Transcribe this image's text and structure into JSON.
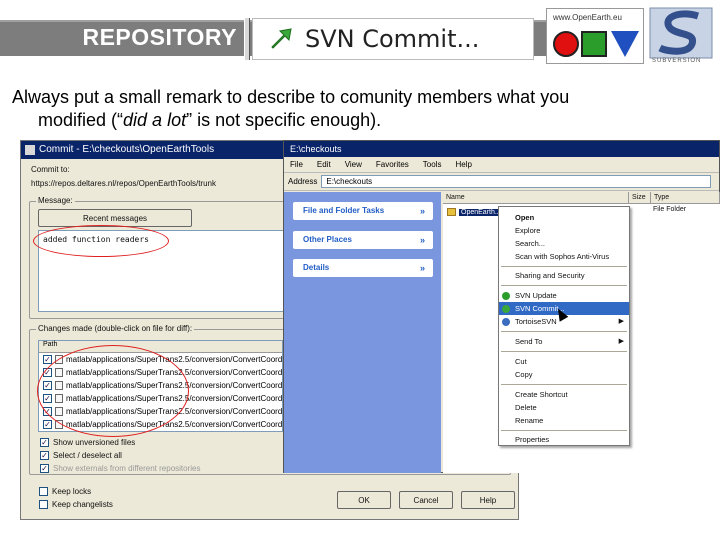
{
  "slide": {
    "title": "REPOSITORY",
    "svn_title": "SVN Commit...",
    "openearth_url": "www.OpenEarth.eu",
    "subversion_label": "SUBVERSION",
    "remark_line1": "Always put a small remark to describe to comunity members what you",
    "remark_line2_a": "modified (“",
    "remark_line2_italic": "did a lot",
    "remark_line2_b": "” is not specific enough)."
  },
  "commit_dialog": {
    "title": "Commit - E:\\checkouts\\OpenEarthTools",
    "commit_to_label": "Commit to:",
    "commit_to_url": "https://repos.deltares.nl/repos/OpenEarthTools/trunk",
    "message_group": "Message:",
    "recent_messages_button": "Recent messages",
    "message_text": "added function readers",
    "changes_group": "Changes made (double-click on file for diff):",
    "file_column": "Path",
    "files": [
      "matlab/applications/SuperTrans2.5/conversion/ConvertCoord",
      "matlab/applications/SuperTrans2.5/conversion/ConvertCoord",
      "matlab/applications/SuperTrans2.5/conversion/ConvertCoord",
      "matlab/applications/SuperTrans2.5/conversion/ConvertCoord",
      "matlab/applications/SuperTrans2.5/conversion/ConvertCoord",
      "matlab/applications/SuperTrans2.5/conversion/ConvertCoord"
    ],
    "show_unversioned": "Show unversioned files",
    "select_deselect": "Select / deselect all",
    "show_externals": "Show externals from different repositories",
    "keep_locks": "Keep locks",
    "keep_changelists": "Keep changelists",
    "ok_button": "OK",
    "cancel_button": "Cancel",
    "help_button": "Help"
  },
  "explorer": {
    "title": "E:\\checkouts",
    "menu": [
      "File",
      "Edit",
      "View",
      "Favorites",
      "Tools",
      "Help"
    ],
    "address_label": "Address",
    "address_value": "E:\\checkouts",
    "panels": [
      "File and Folder Tasks",
      "Other Places",
      "Details"
    ],
    "columns": [
      "Name",
      "Size",
      "Type"
    ],
    "selected_item": "OpenEarth...",
    "selected_type": "File Folder"
  },
  "context_menu": {
    "items": [
      "Open",
      "Explore",
      "Search...",
      "Scan with Sophos Anti-Virus",
      "Sharing and Security",
      "SVN Update",
      "SVN Commit...",
      "TortoiseSVN",
      "Send To",
      "Cut",
      "Copy",
      "Create Shortcut",
      "Delete",
      "Rename",
      "Properties"
    ],
    "highlighted": "SVN Commit..."
  },
  "colors": {
    "header_bar": "#7d7d7d",
    "highlight": "#316ac5",
    "title_bar": "#0a246a",
    "annotation": "#e02020"
  }
}
